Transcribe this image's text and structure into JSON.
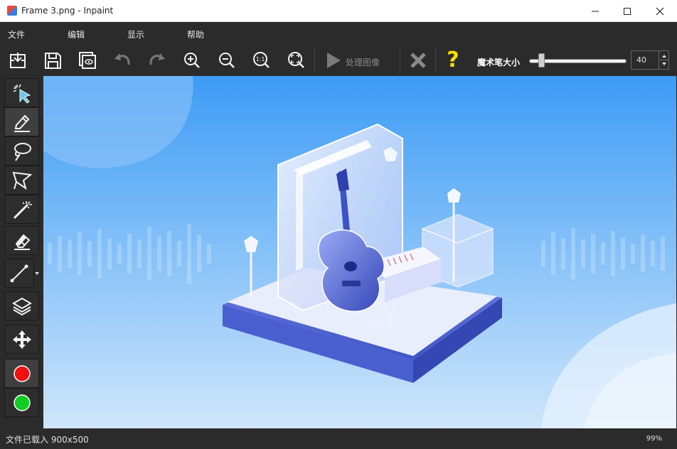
{
  "window": {
    "title": "Frame 3.png - Inpaint"
  },
  "menu": {
    "items": [
      "文件",
      "编辑",
      "显示",
      "帮助"
    ]
  },
  "toolbar": {
    "process_label": "处理图像",
    "brush_size_label": "魔术笔大小",
    "brush_size_value": "40",
    "brush_size_fraction": 0.1,
    "question_mark": "?"
  },
  "status": {
    "text": "文件已载入 900x500",
    "zoom": "99%"
  },
  "colors": {
    "accent": "#ffdd00",
    "red": "#ee1111",
    "green": "#11cc22",
    "canvas_top": "#3d9cf5",
    "canvas_bottom": "#cfe6fb"
  },
  "icons": [
    "open-file-icon",
    "save-icon",
    "preview-icon",
    "undo-icon",
    "redo-icon",
    "zoom-in-icon",
    "zoom-out-icon",
    "actual-size-icon",
    "fit-icon",
    "play-icon",
    "close-icon",
    "help-icon",
    "magic-pointer-icon",
    "marker-icon",
    "lasso-icon",
    "polygon-lasso-icon",
    "magic-wand-icon",
    "eraser-icon",
    "line-icon",
    "layers-icon",
    "move-icon"
  ]
}
